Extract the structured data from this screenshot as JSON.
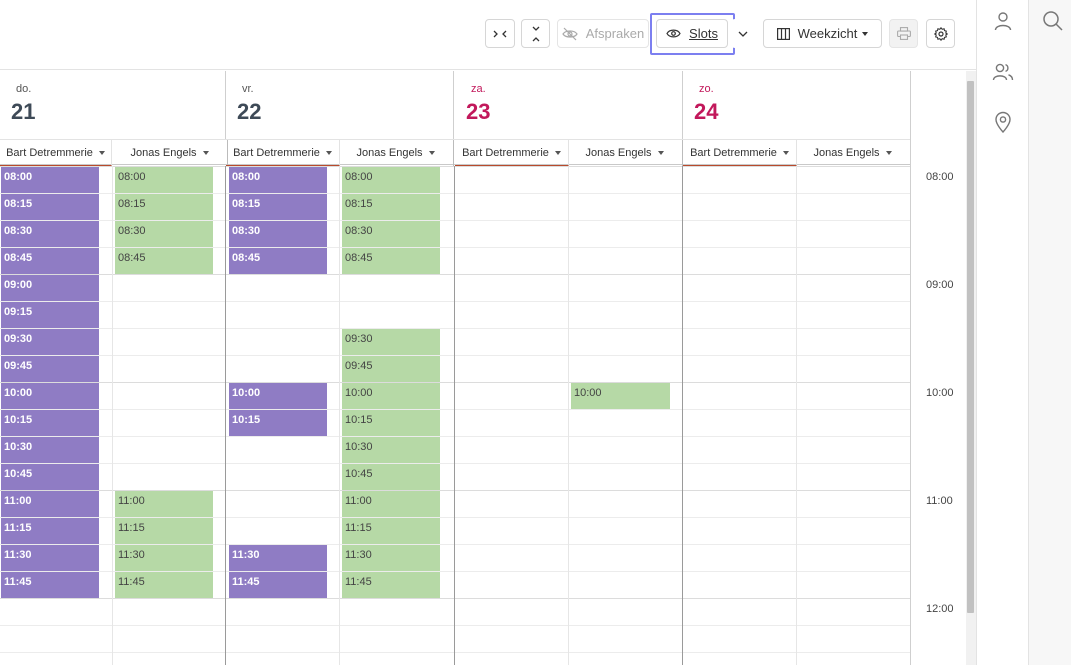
{
  "toolbar": {
    "appointments_label": "Afspraken",
    "slots_label": "Slots",
    "view_label": "Weekzicht"
  },
  "days": [
    {
      "name": "do.",
      "number": "21",
      "weekend": false
    },
    {
      "name": "vr.",
      "number": "22",
      "weekend": false
    },
    {
      "name": "za.",
      "number": "23",
      "weekend": true
    },
    {
      "name": "zo.",
      "number": "24",
      "weekend": true
    }
  ],
  "resources": [
    "Bart Detremmerie",
    "Jonas Engels"
  ],
  "time_labels": [
    "08:00",
    "09:00",
    "10:00",
    "11:00",
    "12:00"
  ],
  "slot_times": [
    "08:00",
    "08:15",
    "08:30",
    "08:45",
    "09:00",
    "09:15",
    "09:30",
    "09:45",
    "10:00",
    "10:15",
    "10:30",
    "10:45",
    "11:00",
    "11:15",
    "11:30",
    "11:45"
  ],
  "slots": [
    {
      "day": 0,
      "resource": 0,
      "times": [
        "08:00",
        "08:15",
        "08:30",
        "08:45",
        "09:00",
        "09:15",
        "09:30",
        "09:45",
        "10:00",
        "10:15",
        "10:30",
        "10:45",
        "11:00",
        "11:15",
        "11:30",
        "11:45"
      ]
    },
    {
      "day": 0,
      "resource": 1,
      "times": [
        "08:00",
        "08:15",
        "08:30",
        "08:45",
        "11:00",
        "11:15",
        "11:30",
        "11:45"
      ]
    },
    {
      "day": 1,
      "resource": 0,
      "times": [
        "08:00",
        "08:15",
        "08:30",
        "08:45",
        "10:00",
        "10:15",
        "11:30",
        "11:45"
      ]
    },
    {
      "day": 1,
      "resource": 1,
      "times": [
        "08:00",
        "08:15",
        "08:30",
        "08:45",
        "09:30",
        "09:45",
        "10:00",
        "10:15",
        "10:30",
        "10:45",
        "11:00",
        "11:15",
        "11:30",
        "11:45"
      ]
    },
    {
      "day": 2,
      "resource": 1,
      "times": [
        "10:00"
      ]
    }
  ],
  "colors": {
    "resource_0": "#8f7cc4",
    "resource_1": "#b6d9a6",
    "weekend_text": "#c2185b",
    "highlight": "#7c7ff0"
  }
}
